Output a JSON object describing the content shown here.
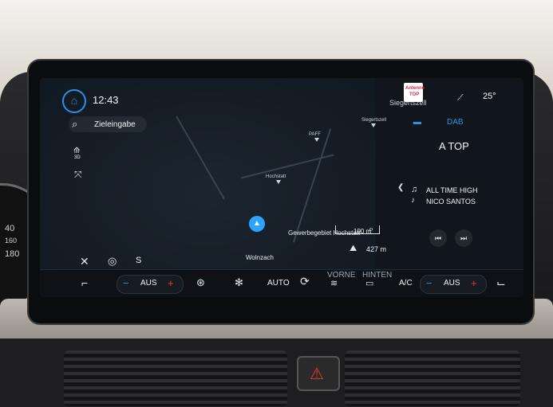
{
  "status_bar": {
    "time": "12:43",
    "temperature": "25°",
    "place_top": "Siegertszell"
  },
  "search": {
    "label": "Zieleingabe"
  },
  "map": {
    "view_mode": "3D",
    "place_labels": [
      "PAFF",
      "Siegertszell",
      "Hochstatt",
      "Wolnzach"
    ],
    "destination_label": "Gewerbegebiet Hochstatt",
    "scale": "100 m",
    "distance": "427 m",
    "compass": "S"
  },
  "media": {
    "source": "DAB",
    "station": "A TOP",
    "logo_text": [
      "Antenne",
      "TOP"
    ],
    "song_title": "ALL TIME HIGH",
    "artist": "NICO SANTOS"
  },
  "climate": {
    "driver_temp": "AUS",
    "passenger_temp": "AUS",
    "auto_label": "AUTO",
    "front_label": "VORNE",
    "rear_label": "HINTEN",
    "ac_label": "A/C",
    "minus": "−",
    "plus": "+"
  },
  "dashboard": {
    "gauge_numbers": [
      "40",
      "160",
      "180"
    ]
  },
  "colors": {
    "accent_blue": "#2f8fe0",
    "plus_red": "#e23a3a",
    "screen_bg": "#11161c"
  }
}
